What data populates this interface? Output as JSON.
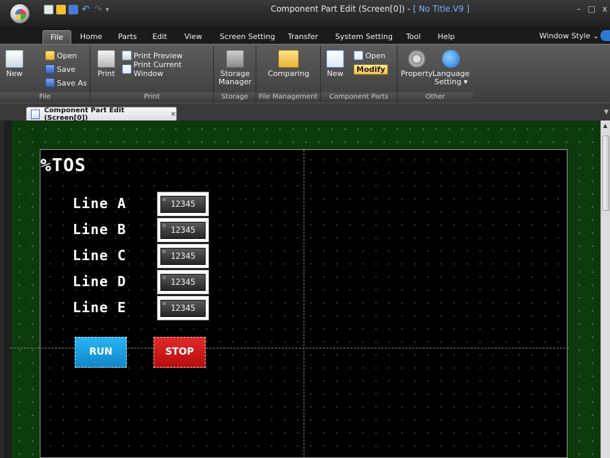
{
  "window": {
    "title_prefix": "Component Part Edit (Screen[0]) - ",
    "title_doc": "[ No Title.V9 ]",
    "min": "–",
    "max": "□",
    "close": "x"
  },
  "ribbon_tabs": [
    "File",
    "Home",
    "Parts",
    "Edit",
    "View",
    "Screen Setting",
    "Transfer",
    "System Setting",
    "Tool",
    "Help"
  ],
  "window_style": "Window Style ⌄",
  "groups": {
    "file": {
      "label": "File",
      "new": "New",
      "open": "Open",
      "save": "Save",
      "save_as": "Save As"
    },
    "print": {
      "label": "Print",
      "print": "Print",
      "preview": "Print Preview",
      "current": "Print Current Window"
    },
    "storage": {
      "label": "Storage",
      "manager_1": "Storage",
      "manager_2": "Manager"
    },
    "file_mgmt": {
      "label": "File Management",
      "comparing": "Comparing"
    },
    "component_parts": {
      "label": "Component Parts",
      "new": "New",
      "open": "Open",
      "modify": "Modify"
    },
    "other": {
      "label": "Other",
      "property": "Property",
      "language_1": "Language",
      "language_2": "Setting ▾"
    }
  },
  "doc_tab": {
    "label": "Component Part Edit (Screen[0])",
    "close": "✕"
  },
  "canvas": {
    "title": "%TOS",
    "lines": [
      {
        "label": "Line A",
        "value": "12345"
      },
      {
        "label": "Line B",
        "value": "12345"
      },
      {
        "label": "Line C",
        "value": "12345"
      },
      {
        "label": "Line D",
        "value": "12345"
      },
      {
        "label": "Line E",
        "value": "12345"
      }
    ],
    "run_label": "RUN",
    "stop_label": "STOP"
  }
}
